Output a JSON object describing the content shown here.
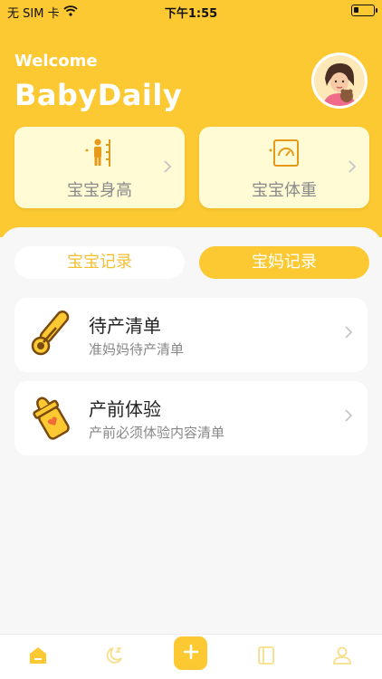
{
  "status_bar": {
    "carrier": "无 SIM 卡",
    "wifi_icon": "wifi-icon",
    "time": "下午1:55",
    "battery_level": 0.2
  },
  "header": {
    "welcome": "Welcome",
    "title": "BabyDaily",
    "avatar_icon": "avatar-mother-baby"
  },
  "measure_cards": [
    {
      "label": "宝宝身高",
      "icon": "height-measure-icon"
    },
    {
      "label": "宝宝体重",
      "icon": "weight-scale-icon"
    }
  ],
  "tabs": [
    {
      "label": "宝宝记录",
      "selected": false
    },
    {
      "label": "宝妈记录",
      "selected": true
    }
  ],
  "list": [
    {
      "title": "待产清单",
      "subtitle": "准妈妈待产清单",
      "icon": "thermometer-icon"
    },
    {
      "title": "产前体验",
      "subtitle": "产前必须体验内容清单",
      "icon": "baby-bottle-icon"
    }
  ],
  "bottom_nav": {
    "items": [
      "home-icon",
      "moon-sleep-icon",
      "add-icon",
      "book-icon",
      "user-icon"
    ],
    "active": "home-icon"
  },
  "colors": {
    "primary": "#fcc932",
    "card_bg": "#fffbd4",
    "tab_text": "#f2c033",
    "icon_orange": "#e79a1a"
  }
}
